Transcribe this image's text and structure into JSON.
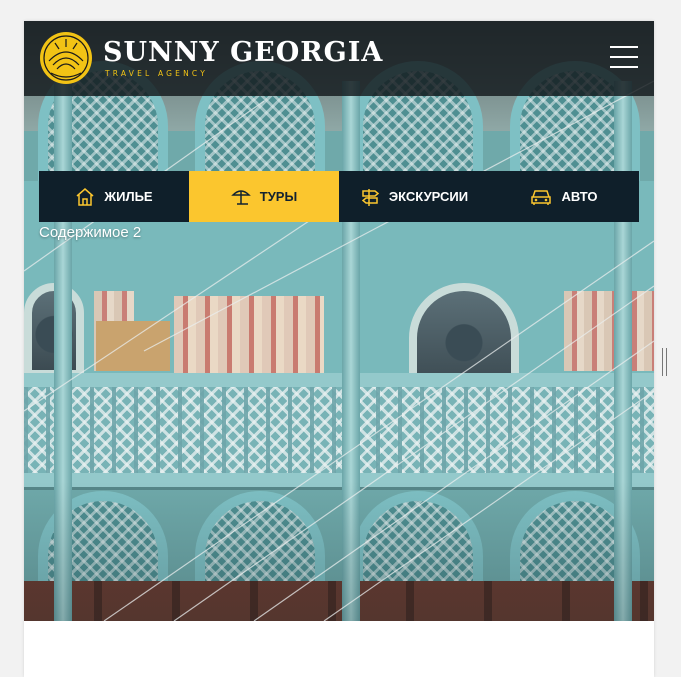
{
  "header": {
    "brand_title": "SUNNY GEORGIA",
    "brand_subtitle": "TRAVEL AGENCY",
    "menu_icon": "hamburger-menu-icon"
  },
  "nav": {
    "tabs": [
      {
        "label": "ЖИЛЬЕ",
        "icon": "house-icon",
        "active": false
      },
      {
        "label": "ТУРЫ",
        "icon": "beach-umbrella-icon",
        "active": true
      },
      {
        "label": "ЭКСКУРСИИ",
        "icon": "signpost-icon",
        "active": false
      },
      {
        "label": "АВТО",
        "icon": "car-icon",
        "active": false
      }
    ]
  },
  "content": {
    "label": "Содержимое 2"
  },
  "colors": {
    "accent": "#fbc62e",
    "brand_gold": "#f2c315",
    "nav_dark": "#0f1f2a",
    "header_bg": "#12181c"
  }
}
